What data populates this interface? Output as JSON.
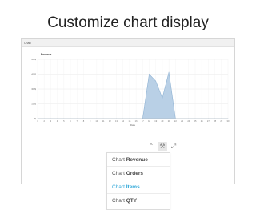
{
  "slide": {
    "title": "Customize chart display"
  },
  "panel": {
    "header_label": "Chart"
  },
  "chart_data": {
    "type": "area",
    "title": "Revenue",
    "xlabel": "Date",
    "ylabel": "",
    "x": [
      "1",
      "2",
      "3",
      "4",
      "5",
      "6",
      "7",
      "8",
      "9",
      "10",
      "11",
      "12",
      "13",
      "14",
      "15",
      "16",
      "17",
      "18",
      "19",
      "20",
      "21",
      "22",
      "23",
      "24",
      "25",
      "26",
      "27",
      "28",
      "29",
      "30"
    ],
    "series": [
      {
        "name": "Revenue",
        "values": [
          0,
          0,
          0,
          0,
          0,
          0,
          0,
          0,
          0,
          0,
          0,
          0,
          0,
          0,
          0,
          0,
          0,
          450,
          380,
          210,
          470,
          0,
          0,
          0,
          0,
          0,
          0,
          0,
          0,
          0
        ]
      }
    ],
    "ylim": [
      0,
      600
    ],
    "yticks": [
      0,
      150,
      300,
      450,
      600
    ],
    "ytick_labels": [
      "0$",
      "150$",
      "300$",
      "450$",
      "600$"
    ],
    "grid": true,
    "colors": {
      "fill": "#b9d0e6",
      "stroke": "#8fb2d3",
      "grid": "#e8e8e8"
    }
  },
  "toolbar": {
    "items": [
      {
        "icon": "chevron-up-icon",
        "glyph": "⌃"
      },
      {
        "icon": "wrench-icon",
        "glyph": "⚒"
      },
      {
        "icon": "expand-icon",
        "glyph": "⤢"
      }
    ]
  },
  "menu": {
    "prefix": "Chart",
    "items": [
      {
        "metric": "Revenue",
        "selected": false
      },
      {
        "metric": "Orders",
        "selected": false
      },
      {
        "metric": "Items",
        "selected": true
      },
      {
        "metric": "QTY",
        "selected": false
      }
    ]
  }
}
